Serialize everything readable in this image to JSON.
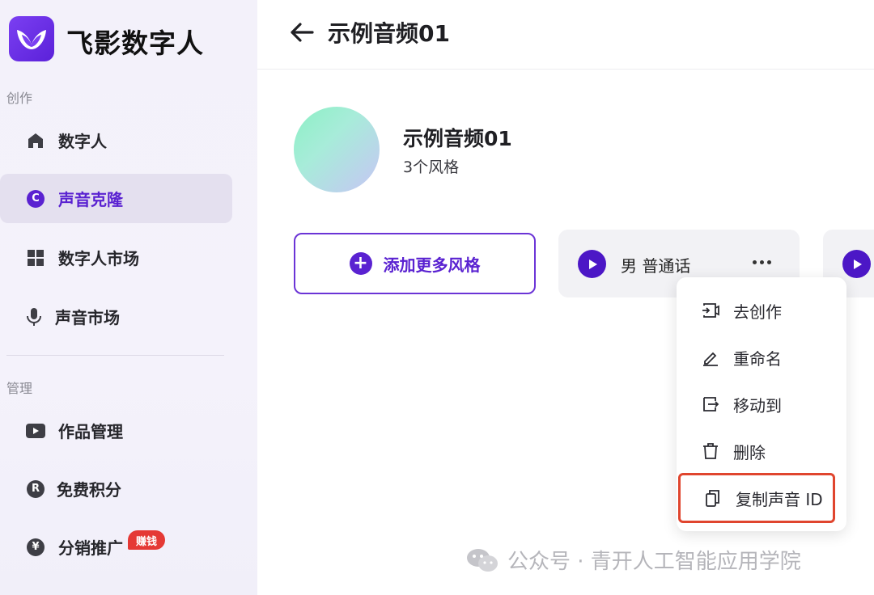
{
  "app": {
    "brand": "飞影数字人"
  },
  "sidebar": {
    "section_create": "创作",
    "section_manage": "管理",
    "items": [
      {
        "label": "数字人",
        "icon": "home-icon"
      },
      {
        "label": "声音克隆",
        "icon": "c-circle-icon",
        "glyph": "C",
        "active": true
      },
      {
        "label": "数字人市场",
        "icon": "grid-icon"
      },
      {
        "label": "声音市场",
        "icon": "microphone-icon"
      },
      {
        "label": "作品管理",
        "icon": "video-play-icon"
      },
      {
        "label": "免费积分",
        "icon": "r-circle-icon",
        "glyph": "R"
      },
      {
        "label": "分销推广",
        "icon": "yen-circle-icon",
        "glyph": "¥",
        "badge": "赚钱"
      }
    ]
  },
  "header": {
    "title": "示例音频01"
  },
  "voice": {
    "name": "示例音频01",
    "styles_count": "3个风格"
  },
  "actions": {
    "add_style": "添加更多风格"
  },
  "styles": [
    {
      "label": "男 普通话"
    }
  ],
  "menu": {
    "items": [
      {
        "label": "去创作",
        "icon": "create-video-icon"
      },
      {
        "label": "重命名",
        "icon": "pencil-icon"
      },
      {
        "label": "移动到",
        "icon": "move-icon"
      },
      {
        "label": "删除",
        "icon": "trash-icon"
      },
      {
        "label": "复制声音 ID",
        "icon": "copy-icon",
        "highlighted": true
      }
    ]
  },
  "watermark": {
    "text": "公众号 · 青开人工智能应用学院"
  },
  "colors": {
    "accent": "#5a22d1",
    "highlight_border": "#e0452e",
    "badge": "#e53935"
  }
}
